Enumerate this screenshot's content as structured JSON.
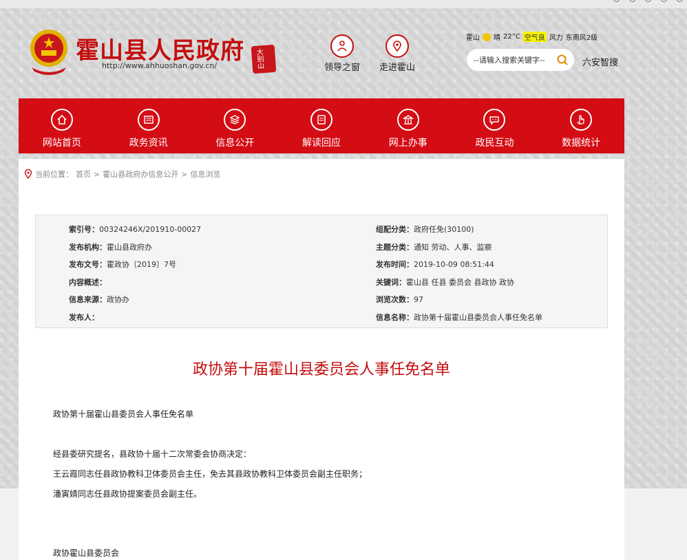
{
  "site": {
    "title": "霍山县人民政府",
    "url": "http://www.ahhuoshan.gov.cn/",
    "seal_text": "大别山"
  },
  "quick_links": [
    {
      "label": "领导之窗",
      "icon": "leader-icon"
    },
    {
      "label": "走进霍山",
      "icon": "location-icon"
    }
  ],
  "weather": {
    "city": "霍山",
    "condition": "晴",
    "temp": "22°C",
    "air_label": "空气良",
    "wind_label": "风力",
    "wind": "东南风2级"
  },
  "search": {
    "placeholder": "--请输入搜索关键字--",
    "six_link": "六安智搜"
  },
  "nav": [
    {
      "label": "网站首页",
      "icon": "home-icon"
    },
    {
      "label": "政务资讯",
      "icon": "news-icon"
    },
    {
      "label": "信息公开",
      "icon": "layers-icon"
    },
    {
      "label": "解读回应",
      "icon": "document-icon"
    },
    {
      "label": "网上办事",
      "icon": "building-icon"
    },
    {
      "label": "政民互动",
      "icon": "chat-icon"
    },
    {
      "label": "数据统计",
      "icon": "hand-icon"
    }
  ],
  "breadcrumb": {
    "prefix": "当前位置：",
    "items": [
      "首页",
      "霍山县政府办信息公开",
      "信息浏览"
    ],
    "sep": ">"
  },
  "meta": {
    "index_label": "索引号：",
    "index": "00324246X/201910-00027",
    "org_label": "发布机构：",
    "org": "霍山县政府办",
    "docno_label": "发布文号：",
    "docno": "霍政协〔2019〕7号",
    "summary_label": "内容概述：",
    "summary": "",
    "source_label": "信息来源：",
    "source": "政协办",
    "publisher_label": "发布人：",
    "publisher": "",
    "group_label": "组配分类：",
    "group": "政府任免(30100)",
    "topic_label": "主题分类：",
    "topic": "通知  劳动、人事、监察",
    "time_label": "发布时间：",
    "time": "2019-10-09 08:51:44",
    "keywords_label": "关键词：",
    "keywords": "霍山县  任县  委员会  县政协  政协",
    "views_label": "浏览次数：",
    "views": "97",
    "name_label": "信息名称：",
    "name": "政协第十届霍山县委员会人事任免名单"
  },
  "article": {
    "title": "政协第十届霍山县委员会人事任免名单",
    "p1": "政协第十届霍山县委员会人事任免名单",
    "p2": "经县委研究提名，县政协十届十二次常委会协商决定：",
    "p3": "王云霞同志任县政协教科卫体委员会主任，免去其县政协教科卫体委员会副主任职务；",
    "p4": "潘寅婧同志任县政协提案委员会副主任。",
    "p5": "政协霍山县委员会"
  },
  "colors": {
    "brand_red": "#d40c14",
    "title_red": "#c40d0d"
  }
}
